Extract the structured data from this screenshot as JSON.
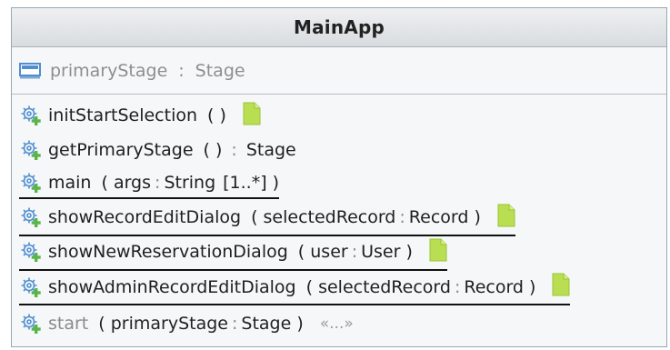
{
  "class_name": "MainApp",
  "attributes": [
    {
      "name": "primaryStage",
      "type": "Stage",
      "icon": "field-icon"
    }
  ],
  "operations": [
    {
      "id": "initStartSelection",
      "name": "initStartSelection",
      "sig_open": "( )",
      "return_type": null,
      "static": false,
      "inherited": false,
      "doc": true
    },
    {
      "id": "getPrimaryStage",
      "name": "getPrimaryStage",
      "sig_open": "( )",
      "return_type": "Stage",
      "static": false,
      "inherited": false,
      "doc": false
    },
    {
      "id": "main",
      "name": "main",
      "param_name": "args",
      "param_type": "String",
      "multiplicity": "[1..*]",
      "static": true,
      "inherited": false,
      "doc": false
    },
    {
      "id": "showRecordEditDialog",
      "name": "showRecordEditDialog",
      "param_name": "selectedRecord",
      "param_type": "Record",
      "static": true,
      "inherited": false,
      "doc": true
    },
    {
      "id": "showNewReservationDialog",
      "name": "showNewReservationDialog",
      "param_name": "user",
      "param_type": "User",
      "static": true,
      "inherited": false,
      "doc": true
    },
    {
      "id": "showAdminRecordEditDialog",
      "name": "showAdminRecordEditDialog",
      "param_name": "selectedRecord",
      "param_type": "Record",
      "static": true,
      "inherited": false,
      "doc": true
    },
    {
      "id": "start",
      "name": "start",
      "param_name": "primaryStage",
      "param_type": "Stage",
      "static": false,
      "inherited": true,
      "doc": false,
      "stereotype": "«...»"
    }
  ],
  "icons": {
    "operation": "gear-plus-icon",
    "attribute": "field-icon",
    "doc": "document-icon"
  },
  "colors": {
    "gear": "#4f8fd0",
    "plus": "#58b548",
    "doc": "#b9de52",
    "border": "#9aa7b3"
  }
}
